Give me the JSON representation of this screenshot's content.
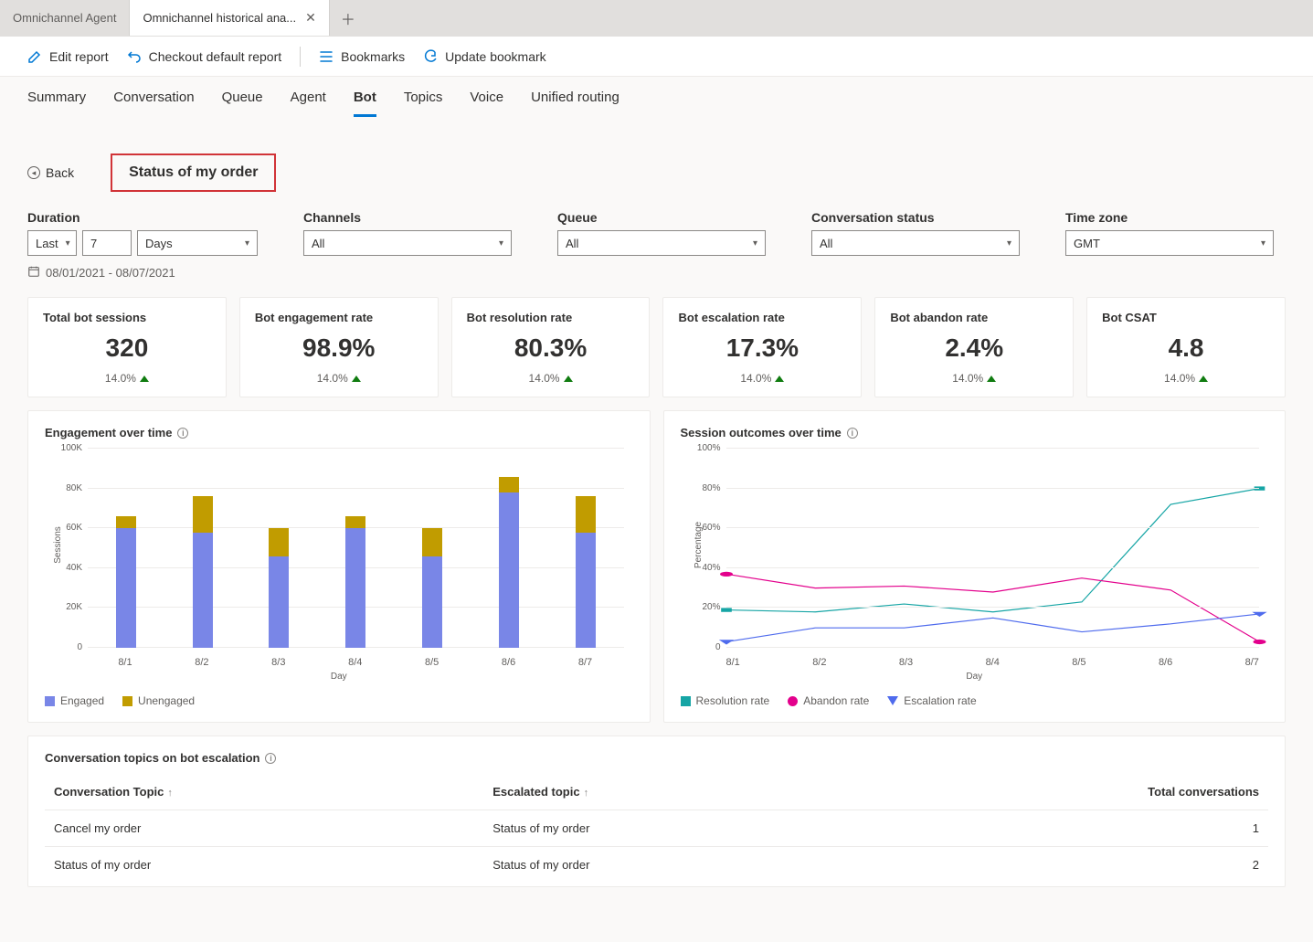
{
  "app_tabs": {
    "items": [
      {
        "label": "Omnichannel Agent"
      },
      {
        "label": "Omnichannel historical ana..."
      }
    ]
  },
  "commands": {
    "edit": "Edit report",
    "checkout": "Checkout default report",
    "bookmarks": "Bookmarks",
    "update": "Update bookmark"
  },
  "page_tabs": [
    "Summary",
    "Conversation",
    "Queue",
    "Agent",
    "Bot",
    "Topics",
    "Voice",
    "Unified routing"
  ],
  "active_page_tab": "Bot",
  "back_label": "Back",
  "topic_title": "Status of my order",
  "filters": {
    "duration": {
      "label": "Duration",
      "mode": "Last",
      "value": "7",
      "unit": "Days"
    },
    "channels": {
      "label": "Channels",
      "value": "All"
    },
    "queue": {
      "label": "Queue",
      "value": "All"
    },
    "status": {
      "label": "Conversation status",
      "value": "All"
    },
    "timezone": {
      "label": "Time zone",
      "value": "GMT"
    }
  },
  "date_range": "08/01/2021 - 08/07/2021",
  "kpis": [
    {
      "title": "Total bot sessions",
      "value": "320",
      "trend": "14.0%"
    },
    {
      "title": "Bot engagement rate",
      "value": "98.9%",
      "trend": "14.0%"
    },
    {
      "title": "Bot resolution rate",
      "value": "80.3%",
      "trend": "14.0%"
    },
    {
      "title": "Bot escalation rate",
      "value": "17.3%",
      "trend": "14.0%"
    },
    {
      "title": "Bot abandon rate",
      "value": "2.4%",
      "trend": "14.0%"
    },
    {
      "title": "Bot CSAT",
      "value": "4.8",
      "trend": "14.0%"
    }
  ],
  "chart1": {
    "title": "Engagement over time",
    "ylabel": "Sessions",
    "xlabel": "Day",
    "legend": [
      "Engaged",
      "Unengaged"
    ]
  },
  "chart2": {
    "title": "Session outcomes over time",
    "ylabel": "Percentage",
    "xlabel": "Day",
    "legend": [
      "Resolution rate",
      "Abandon rate",
      "Escalation rate"
    ]
  },
  "chart_data": [
    {
      "type": "bar",
      "title": "Engagement over time",
      "xlabel": "Day",
      "ylabel": "Sessions",
      "ylim": [
        0,
        100000
      ],
      "yticks": [
        "0",
        "20K",
        "40K",
        "60K",
        "80K",
        "100K"
      ],
      "categories": [
        "8/1",
        "8/2",
        "8/3",
        "8/4",
        "8/5",
        "8/6",
        "8/7"
      ],
      "series": [
        {
          "name": "Engaged",
          "values": [
            60000,
            58000,
            46000,
            60000,
            46000,
            78000,
            58000
          ]
        },
        {
          "name": "Unengaged",
          "values": [
            6000,
            18000,
            14000,
            6000,
            14000,
            8000,
            18000
          ]
        }
      ]
    },
    {
      "type": "line",
      "title": "Session outcomes over time",
      "xlabel": "Day",
      "ylabel": "Percentage",
      "ylim": [
        0,
        100
      ],
      "yticks": [
        "0",
        "20%",
        "40%",
        "60%",
        "80%",
        "100%"
      ],
      "categories": [
        "8/1",
        "8/2",
        "8/3",
        "8/4",
        "8/5",
        "8/6",
        "8/7"
      ],
      "series": [
        {
          "name": "Resolution rate",
          "values": [
            19,
            18,
            22,
            18,
            23,
            72,
            80
          ]
        },
        {
          "name": "Abandon rate",
          "values": [
            37,
            30,
            31,
            28,
            35,
            29,
            3
          ]
        },
        {
          "name": "Escalation rate",
          "values": [
            3,
            10,
            10,
            15,
            8,
            12,
            17
          ]
        }
      ]
    }
  ],
  "table": {
    "title": "Conversation topics on bot escalation",
    "columns": [
      "Conversation Topic",
      "Escalated topic",
      "Total conversations"
    ],
    "rows": [
      {
        "topic": "Cancel my order",
        "escalated": "Status of my order",
        "total": "1"
      },
      {
        "topic": "Status of my order",
        "escalated": "Status of my order",
        "total": "2"
      }
    ]
  }
}
